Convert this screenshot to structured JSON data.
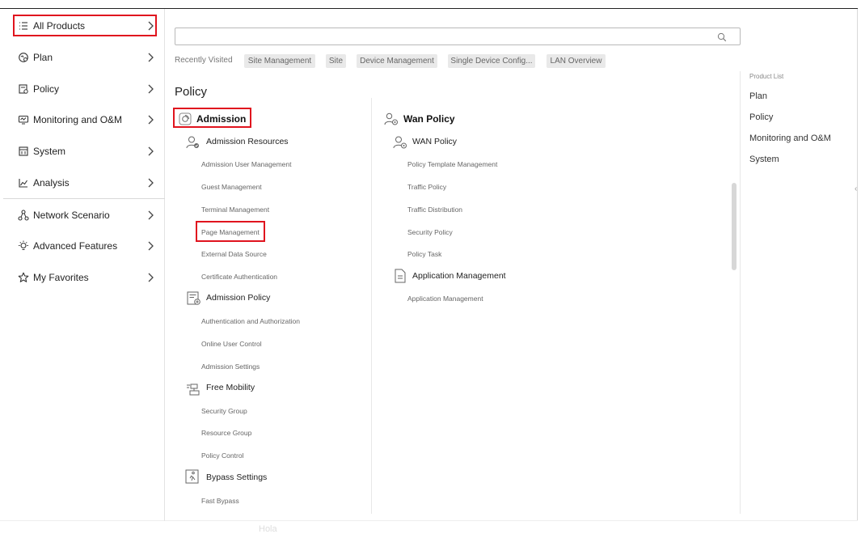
{
  "sidebar": {
    "items": [
      {
        "label": "All Products",
        "icon": "list-icon"
      },
      {
        "label": "Plan",
        "icon": "plan-icon"
      },
      {
        "label": "Policy",
        "icon": "policy-icon"
      },
      {
        "label": "Monitoring and O&M",
        "icon": "monitor-icon"
      },
      {
        "label": "System",
        "icon": "system-icon"
      },
      {
        "label": "Analysis",
        "icon": "analysis-icon"
      },
      {
        "label": "Network Scenario",
        "icon": "network-icon"
      },
      {
        "label": "Advanced Features",
        "icon": "bulb-icon"
      },
      {
        "label": "My Favorites",
        "icon": "star-icon"
      }
    ]
  },
  "search": {
    "placeholder": "",
    "value": ""
  },
  "recent": {
    "label": "Recently Visited",
    "chips": [
      "Site Management",
      "Site",
      "Device Management",
      "Single Device Config...",
      "LAN Overview"
    ]
  },
  "section": {
    "title": "Policy"
  },
  "left_column": {
    "group_title": "Admission",
    "subsections": [
      {
        "title": "Admission Resources",
        "items": [
          "Admission User Management",
          "Guest Management",
          "Terminal Management",
          "Page Management",
          "External Data Source",
          "Certificate Authentication"
        ]
      },
      {
        "title": "Admission Policy",
        "items": [
          "Authentication and Authorization",
          "Online User Control",
          "Admission Settings"
        ]
      },
      {
        "title": "Free Mobility",
        "items": [
          "Security Group",
          "Resource Group",
          "Policy Control"
        ]
      },
      {
        "title": "Bypass Settings",
        "items": [
          "Fast Bypass"
        ]
      }
    ]
  },
  "right_column": {
    "group_title": "Wan Policy",
    "subsections": [
      {
        "title": "WAN Policy",
        "items": [
          "Policy Template Management",
          "Traffic Policy",
          "Traffic Distribution",
          "Security Policy",
          "Policy Task"
        ]
      },
      {
        "title": "Application Management",
        "items": [
          "Application Management"
        ]
      }
    ]
  },
  "product_list": {
    "label": "Product List",
    "items": [
      "Plan",
      "Policy",
      "Monitoring and O&M",
      "System"
    ]
  },
  "footer_ghost": "Hola",
  "colors": {
    "highlight": "#e0141e",
    "chip_bg": "#e9e9e9"
  }
}
